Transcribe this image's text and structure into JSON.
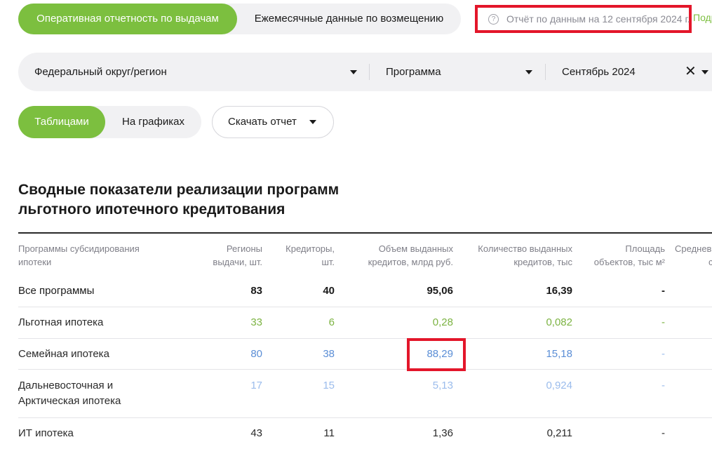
{
  "tabs_top": {
    "operational": "Оперативная отчетность по выдачам",
    "monthly": "Ежемесячные данные по возмещению"
  },
  "report": {
    "date_text": "Отчёт по данным на 12 сентября 2024 г.",
    "subscribe": "Подр"
  },
  "filters": {
    "region": "Федеральный округ/регион",
    "program": "Программа",
    "month": "Сентябрь 2024"
  },
  "view": {
    "tables": "Таблицами",
    "charts": "На графиках",
    "download": "Скачать отчет"
  },
  "title": {
    "line1": "Сводные показатели реализации программ",
    "line2": "льготного ипотечного кредитования"
  },
  "table": {
    "headers": {
      "program": [
        "Программы субсидирования",
        "ипотеки"
      ],
      "regions": [
        "Регионы",
        "выдачи, шт."
      ],
      "creditors": [
        "Кредиторы,",
        "шт."
      ],
      "volume": [
        "Объем выданных",
        "кредитов, млрд руб."
      ],
      "count": [
        "Количество выданных",
        "кредитов, тыс"
      ],
      "area": [
        "Площадь",
        "объектов, тыс м²"
      ],
      "average": [
        "Среднев",
        "с"
      ]
    },
    "rows": [
      {
        "program": "Все программы",
        "regions": "83",
        "creditors": "40",
        "volume": "95,06",
        "count": "16,39",
        "area": "-"
      },
      {
        "program": "Льготная ипотека",
        "regions": "33",
        "creditors": "6",
        "volume": "0,28",
        "count": "0,082",
        "area": "-"
      },
      {
        "program": "Семейная ипотека",
        "regions": "80",
        "creditors": "38",
        "volume": "88,29",
        "count": "15,18",
        "area": "-"
      },
      {
        "program_line1": "Дальневосточная и",
        "program_line2": "Арктическая ипотека",
        "regions": "17",
        "creditors": "15",
        "volume": "5,13",
        "count": "0,924",
        "area": "-"
      },
      {
        "program": "ИТ ипотека",
        "regions": "43",
        "creditors": "11",
        "volume": "1,36",
        "count": "0,211",
        "area": "-"
      }
    ]
  },
  "colors": {
    "accent_green": "#7cbf3f",
    "highlight_red": "#e3162a",
    "row_green": "#7cb342",
    "row_blue": "#5b8ed6",
    "row_lightblue": "#9bbcec"
  }
}
